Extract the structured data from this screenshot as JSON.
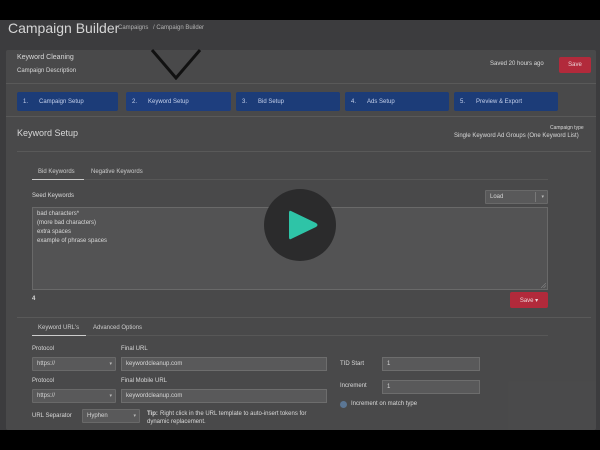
{
  "header": {
    "title": "Campaign Builder",
    "breadcrumbs": [
      "Campaigns",
      "/ Campaign Builder"
    ]
  },
  "campaign": {
    "name": "Keyword Cleaning",
    "description": "Campaign Description",
    "saved_status": "Saved 20 hours ago",
    "save_label": "Save"
  },
  "steps": [
    {
      "num": "1.",
      "label": "Campaign Setup"
    },
    {
      "num": "2.",
      "label": "Keyword Setup"
    },
    {
      "num": "3.",
      "label": "Bid Setup"
    },
    {
      "num": "4.",
      "label": "Ads Setup"
    },
    {
      "num": "5.",
      "label": "Preview & Export"
    }
  ],
  "keyword_setup": {
    "title": "Keyword Setup",
    "campaign_type_label": "Campaign type",
    "campaign_type_value": "Single Keyword Ad Groups (One Keyword List)",
    "tabs": [
      "Bid Keywords",
      "Negative Keywords"
    ],
    "seed_label": "Seed Keywords",
    "load_label": "Load",
    "seed_lines": [
      "bad characters*",
      "(more bad characters)",
      "extra  spaces",
      "example of phrase spaces"
    ],
    "count": "4",
    "save_dropdown_label": "Save ▾"
  },
  "url_section": {
    "tabs": [
      "Keyword URL's",
      "Advanced Options"
    ],
    "protocol_label": "Protocol",
    "protocol_value": "https://",
    "final_url_label": "Final URL",
    "final_url_value": "keywordcleanup.com",
    "protocol2_label": "Protocol",
    "protocol2_value": "https://",
    "final_mobile_label": "Final Mobile URL",
    "final_mobile_value": "keywordcleanup.com",
    "separator_label": "URL Separator",
    "separator_value": "Hyphen",
    "tip_bold": "Tip:",
    "tip_text": "Right click in the URL template to auto-insert tokens for",
    "tip_text2": "dynamic replacement.",
    "tid_start_label": "TID Start",
    "tid_start_value": "1",
    "increment_label": "Increment",
    "increment_value": "1",
    "increment_match_label": "Increment on match type"
  },
  "colors": {
    "accent_red": "#b52a3b",
    "step_blue": "#1c3c7a",
    "play_icon": "#2ec4a7"
  }
}
